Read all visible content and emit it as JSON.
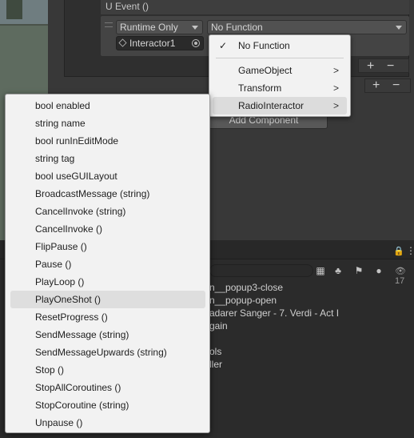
{
  "event": {
    "title": "U Event ()",
    "runtime_dropdown": "Runtime Only",
    "function_dropdown": "No Function",
    "object_field": "Interactor1"
  },
  "buttons": {
    "plus": "+",
    "minus": "−",
    "add_component": "Add Component"
  },
  "function_menu": {
    "checkmark": "✓",
    "items": [
      {
        "label": "No Function"
      },
      {
        "label": "GameObject",
        "submenu": ">"
      },
      {
        "label": "Transform",
        "submenu": ">"
      },
      {
        "label": "RadioInteractor",
        "submenu": ">"
      }
    ]
  },
  "method_menu": {
    "items": [
      "bool enabled",
      "string name",
      "bool runInEditMode",
      "string tag",
      "bool useGUILayout",
      "BroadcastMessage (string)",
      "CancelInvoke (string)",
      "CancelInvoke ()",
      "FlipPause ()",
      "Pause ()",
      "PlayLoop ()",
      "PlayOneShot ()",
      "ResetProgress ()",
      "SendMessage (string)",
      "SendMessageUpwards (string)",
      "Stop ()",
      "StopAllCoroutines ()",
      "StopCoroutine (string)",
      "Unpause ()"
    ],
    "highlighted": "PlayOneShot ()"
  },
  "project_list": {
    "items": [
      "n__popup3-close",
      "n__popup-open",
      "adarer Sanger - 7. Verdi - Act I",
      "gain",
      "",
      "ols",
      "ller"
    ]
  },
  "toolbar": {
    "lock_icon": "🔒",
    "menu_icon": "⋮",
    "eye_count": "17"
  },
  "colors": {
    "editor_bg": "#383838",
    "menu_bg": "#f2f2f2",
    "menu_highlight": "#dedede"
  }
}
